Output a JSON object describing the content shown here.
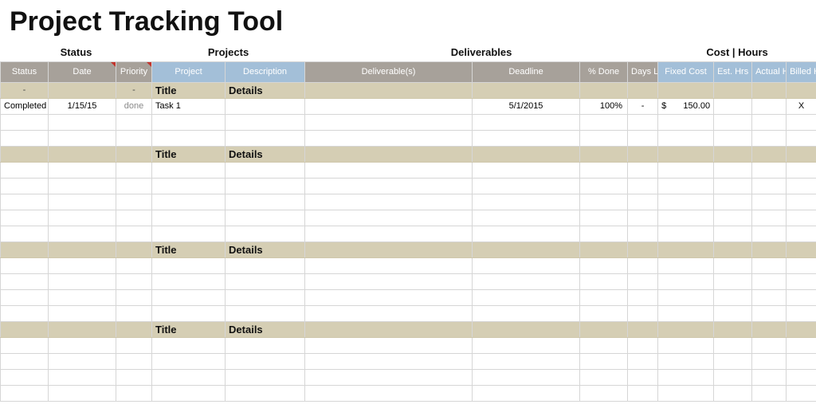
{
  "title": "Project Tracking Tool",
  "groups": {
    "status": "Status",
    "projects": "Projects",
    "deliverables": "Deliverables",
    "costhours": "Cost | Hours"
  },
  "headers": {
    "status": "Status",
    "date": "Date",
    "priority": "Priority",
    "project": "Project",
    "description": "Description",
    "deliverables": "Deliverable(s)",
    "deadline": "Deadline",
    "pdone": "% Done",
    "daysleft": "Days Left",
    "fixedcost": "Fixed Cost",
    "esthrs": "Est. Hrs",
    "actualhrs": "Actual Hrs",
    "billedhrs": "Billed Hrs"
  },
  "tan": {
    "dash": "-",
    "title": "Title",
    "details": "Details"
  },
  "row1": {
    "status": "Completed",
    "date": "1/15/15",
    "priority": "done",
    "project": "Task 1",
    "deadline": "5/1/2015",
    "pdone": "100%",
    "daysleft": "-",
    "cost_currency": "$",
    "cost_amount": "150.00",
    "billed": "X"
  }
}
